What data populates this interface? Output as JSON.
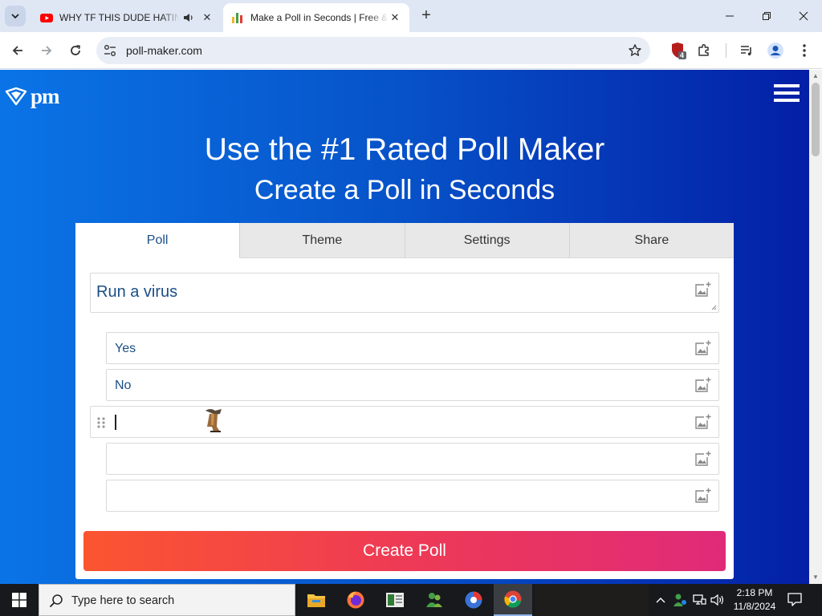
{
  "browser": {
    "tabs": [
      {
        "title": "WHY TF THIS DUDE HATING",
        "favicon": "youtube-icon",
        "audio": true,
        "active": false
      },
      {
        "title": "Make a Poll in Seconds | Free & Easy",
        "favicon": "poll-maker-favicon",
        "audio": false,
        "active": true
      }
    ],
    "url": "poll-maker.com",
    "extension_badge": "4"
  },
  "page": {
    "logo_text": "pm",
    "hero_title": "Use the #1 Rated Poll Maker",
    "hero_subtitle": "Create a Poll in Seconds",
    "tabs": [
      "Poll",
      "Theme",
      "Settings",
      "Share"
    ],
    "active_tab": "Poll",
    "question": "Run a virus",
    "answers": [
      "Yes",
      "No",
      "",
      "",
      ""
    ],
    "create_button": "Create Poll"
  },
  "taskbar": {
    "search_placeholder": "Type here to search",
    "time": "2:18 PM",
    "date": "11/8/2024"
  },
  "colors": {
    "page_gradient_start": "#0a74e6",
    "page_gradient_end": "#031fa6",
    "accent_text": "#1b4f86",
    "cta_start": "#fb5530",
    "cta_end": "#e02a79"
  }
}
